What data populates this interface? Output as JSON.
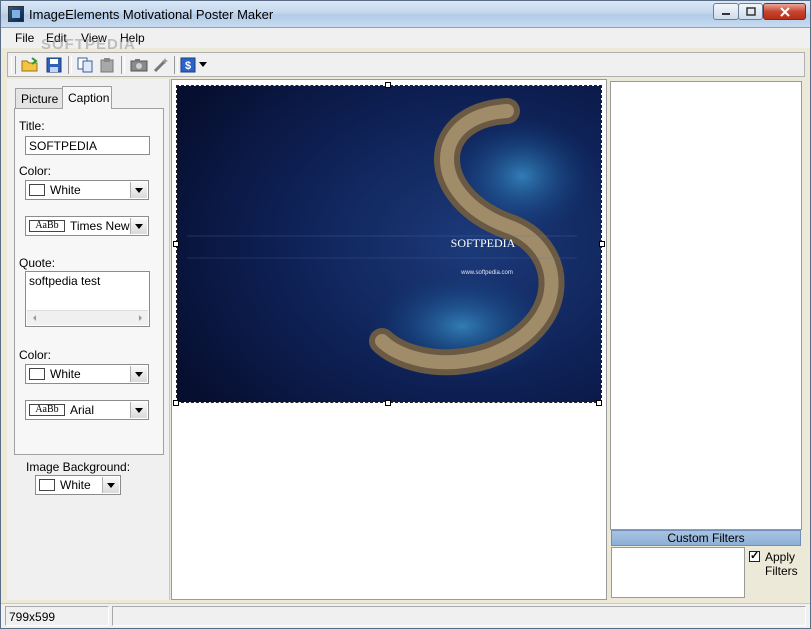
{
  "window": {
    "title": "ImageElements Motivational Poster Maker"
  },
  "menu": {
    "file": "File",
    "edit": "Edit",
    "view": "View",
    "help": "Help"
  },
  "watermark": "SOFTPEDIA",
  "tabs": {
    "picture": "Picture",
    "caption": "Caption"
  },
  "caption": {
    "title_label": "Title:",
    "title_value": "SOFTPEDIA",
    "title_color_label": "Color:",
    "title_color": "White",
    "title_font": "Times New Roman",
    "quote_label": "Quote:",
    "quote_value": "softpedia test",
    "quote_color_label": "Color:",
    "quote_color": "White",
    "quote_font": "Arial",
    "font_sample": "AaBb"
  },
  "background": {
    "label": "Image Background:",
    "value": "White"
  },
  "poster": {
    "title": "SOFTPEDIA",
    "url": "www.softpedia.com"
  },
  "filters": {
    "header": "Custom Filters",
    "apply_line1": "Apply",
    "apply_line2": "Filters",
    "apply_checked": true
  },
  "status": {
    "dimensions": "799x599"
  },
  "colors": {
    "poster_bg": "#0b1a44",
    "header_blue": "#9dbce0"
  }
}
